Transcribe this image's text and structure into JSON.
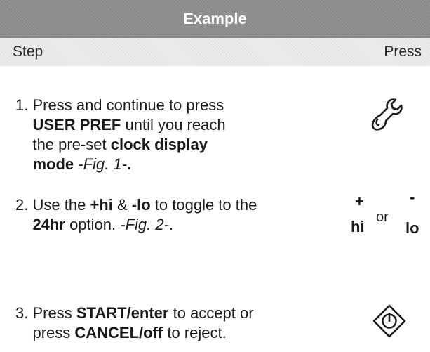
{
  "header": {
    "title": "Example"
  },
  "columns": {
    "step": "Step",
    "press": "Press"
  },
  "steps": [
    {
      "num": "1.",
      "text_a": "Press and continue to press",
      "bold_a": "USER PREF",
      "text_b": "until you reach",
      "text_c": "the pre-set",
      "bold_b": "clock display",
      "bold_c": "mode",
      "italic": "-Fig. 1-",
      "tail": ".",
      "icon": "wrench-icon"
    },
    {
      "num": "2.",
      "text_a": "Use the",
      "bold_a": "+hi",
      "text_b": "&",
      "bold_b": "-lo",
      "text_c": "to toggle to the",
      "bold_c": "24hr",
      "text_d": "option.",
      "italic": "-Fig. 2-",
      "tail": ".",
      "press": {
        "plus": "+",
        "minus": "-",
        "hi": "hi",
        "or": "or",
        "lo": "lo"
      }
    },
    {
      "num": "3.",
      "text_a": "Press",
      "bold_a": "START/enter",
      "text_b": "to accept or",
      "text_c": "press",
      "bold_b": "CANCEL/off",
      "text_d": "to reject.",
      "icon": "start-icon"
    }
  ]
}
